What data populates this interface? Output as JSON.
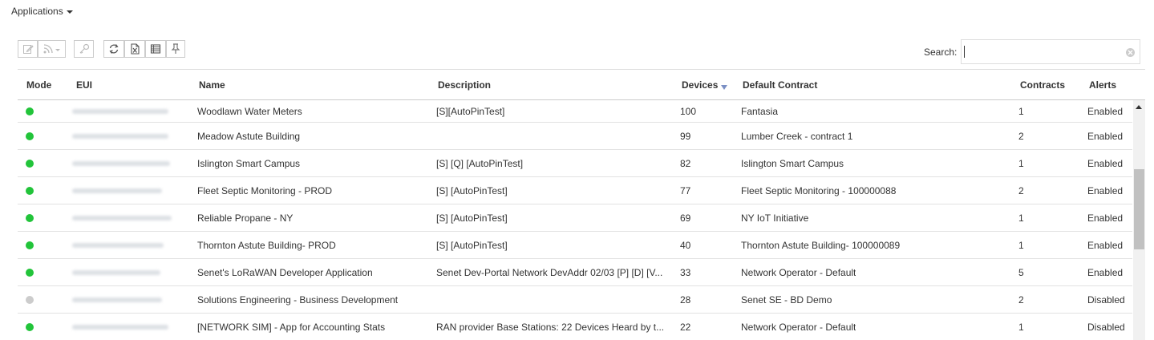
{
  "menu": {
    "label": "Applications"
  },
  "search": {
    "label": "Search:",
    "value": "",
    "placeholder": ""
  },
  "toolbar": {
    "buttons": [
      {
        "icon": "edit-icon"
      },
      {
        "icon": "rss-feed-icon"
      },
      {
        "icon": "key-icon"
      },
      {
        "icon": "refresh-icon"
      },
      {
        "icon": "excel-export-icon"
      },
      {
        "icon": "columns-icon"
      },
      {
        "icon": "pin-icon"
      }
    ]
  },
  "table": {
    "columns": {
      "mode": "Mode",
      "eui": "EUI",
      "name": "Name",
      "description": "Description",
      "devices": "Devices",
      "default_contract": "Default Contract",
      "contracts": "Contracts",
      "alerts": "Alerts"
    },
    "sort": {
      "column": "devices",
      "direction": "descending"
    },
    "rows": [
      {
        "status": "active",
        "name": "Woodlawn Water Meters",
        "description": "[S][AutoPinTest]",
        "devices": "100",
        "default_contract": "Fantasia",
        "contracts": "1",
        "alerts": "Enabled"
      },
      {
        "status": "active",
        "name": "Meadow Astute Building",
        "description": "",
        "devices": "99",
        "default_contract": "Lumber Creek - contract 1",
        "contracts": "2",
        "alerts": "Enabled"
      },
      {
        "status": "active",
        "name": "Islington Smart Campus",
        "description": "[S] [Q] [AutoPinTest]",
        "devices": "82",
        "default_contract": "Islington Smart Campus",
        "contracts": "1",
        "alerts": "Enabled"
      },
      {
        "status": "active",
        "name": "Fleet Septic Monitoring - PROD",
        "description": "[S] [AutoPinTest]",
        "devices": "77",
        "default_contract": "Fleet Septic Monitoring - 100000088",
        "contracts": "2",
        "alerts": "Enabled"
      },
      {
        "status": "active",
        "name": "Reliable Propane - NY",
        "description": "[S] [AutoPinTest]",
        "devices": "69",
        "default_contract": "NY IoT Initiative",
        "contracts": "1",
        "alerts": "Enabled"
      },
      {
        "status": "active",
        "name": "Thornton Astute Building- PROD",
        "description": "[S] [AutoPinTest]",
        "devices": "40",
        "default_contract": "Thornton Astute Building- 100000089",
        "contracts": "1",
        "alerts": "Enabled"
      },
      {
        "status": "active",
        "name": "Senet's LoRaWAN Developer Application",
        "description": "Senet Dev-Portal Network DevAddr 02/03 [P] [D] [V...",
        "devices": "33",
        "default_contract": "Network Operator - Default",
        "contracts": "5",
        "alerts": "Enabled"
      },
      {
        "status": "inactive",
        "name": "Solutions Engineering - Business Development",
        "description": "",
        "devices": "28",
        "default_contract": "Senet SE - BD Demo",
        "contracts": "2",
        "alerts": "Disabled"
      },
      {
        "status": "active",
        "name": "[NETWORK SIM] - App for Accounting Stats",
        "description": "RAN provider Base Stations: 22 Devices Heard by t...",
        "devices": "22",
        "default_contract": "Network Operator - Default",
        "contracts": "1",
        "alerts": "Disabled"
      }
    ]
  },
  "colors": {
    "status_active": "#22c43a",
    "status_inactive": "#cccccc",
    "sort_indicator": "#7a8fc4"
  }
}
